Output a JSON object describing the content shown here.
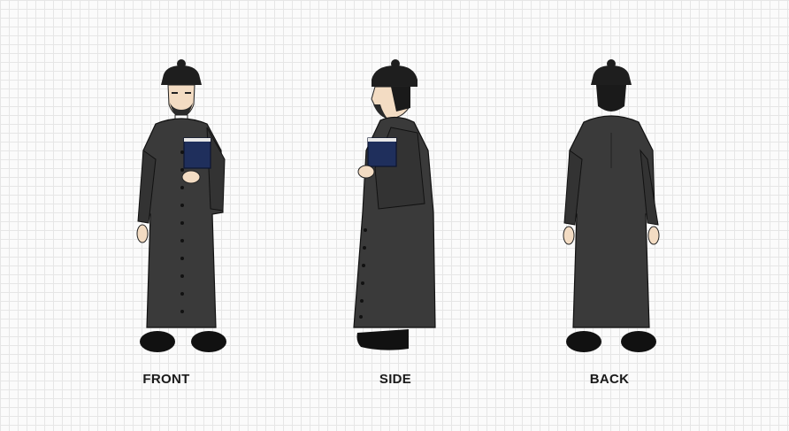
{
  "views": {
    "front": {
      "label": "FRONT",
      "icon": "priest-front-figure"
    },
    "side": {
      "label": "SIDE",
      "icon": "priest-side-figure"
    },
    "back": {
      "label": "BACK",
      "icon": "priest-back-figure"
    }
  },
  "colors": {
    "cassock": "#3a3a3a",
    "cassock_dark": "#262626",
    "hat": "#1e1e1e",
    "book": "#1f2f5c",
    "skin": "#f3dcc3",
    "hair": "#1a1a1a",
    "grid": "#e6e6e6",
    "background": "#fbfbfb"
  }
}
